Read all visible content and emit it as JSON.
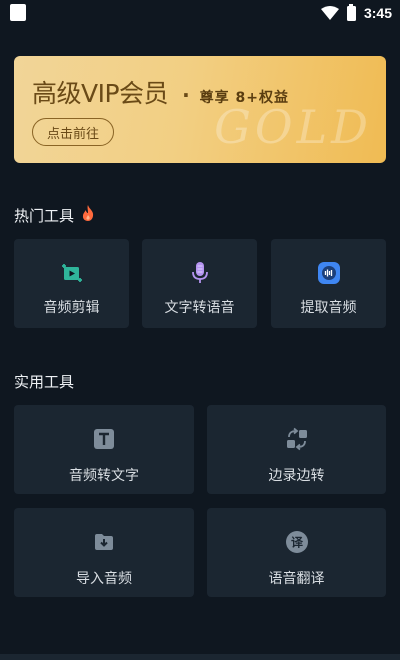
{
  "status_bar": {
    "time": "3:45"
  },
  "vip": {
    "title": "高级VIP会员",
    "dot": "·",
    "subtitle": "尊享 8+权益",
    "button": "点击前往",
    "watermark": "GOLD"
  },
  "sections": {
    "hot": {
      "title": "热门工具"
    },
    "util": {
      "title": "实用工具"
    }
  },
  "hot_tools": [
    {
      "label": "音频剪辑",
      "icon": "video-edit-icon"
    },
    {
      "label": "文字转语音",
      "icon": "microphone-icon"
    },
    {
      "label": "提取音频",
      "icon": "audio-extract-icon"
    }
  ],
  "util_tools": [
    {
      "label": "音频转文字",
      "icon": "text-t-icon"
    },
    {
      "label": "边录边转",
      "icon": "convert-arrows-icon"
    },
    {
      "label": "导入音频",
      "icon": "folder-import-icon"
    },
    {
      "label": "语音翻译",
      "icon": "translate-icon"
    }
  ],
  "colors": {
    "background": "#0f1720",
    "card": "#1b2631",
    "accent_teal": "#3cc3a8",
    "accent_purple": "#b493f0",
    "accent_blue": "#3f86f2",
    "gold": "#f2cf83",
    "flame": "#ff6a3d"
  }
}
